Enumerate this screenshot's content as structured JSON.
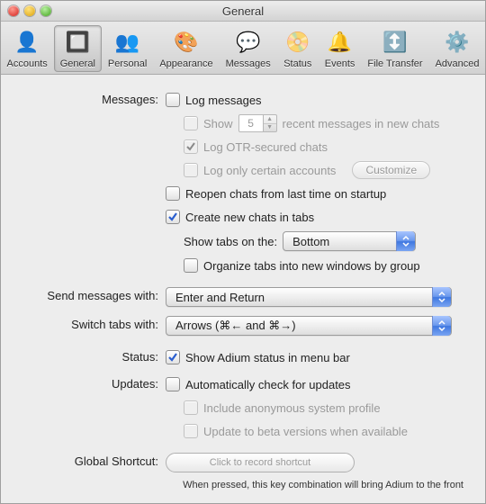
{
  "window": {
    "title": "General"
  },
  "toolbar": {
    "items": [
      {
        "label": "Accounts",
        "icon": "👤",
        "selected": false
      },
      {
        "label": "General",
        "icon": "🔲",
        "selected": true
      },
      {
        "label": "Personal",
        "icon": "👥",
        "selected": false
      },
      {
        "label": "Appearance",
        "icon": "🎨",
        "selected": false
      },
      {
        "label": "Messages",
        "icon": "💬",
        "selected": false
      },
      {
        "label": "Status",
        "icon": "📀",
        "selected": false
      },
      {
        "label": "Events",
        "icon": "🔔",
        "selected": false
      },
      {
        "label": "File Transfer",
        "icon": "↕️",
        "selected": false
      },
      {
        "label": "Advanced",
        "icon": "⚙️",
        "selected": false
      }
    ],
    "selected": "General"
  },
  "sections": {
    "messages": {
      "heading": "Messages:",
      "log_messages": {
        "label": "Log messages",
        "checked": false,
        "enabled": true
      },
      "show_recent": {
        "enabled": false,
        "pre": "Show",
        "value": "5",
        "post": "recent messages in new chats"
      },
      "log_otr": {
        "label": "Log OTR-secured chats",
        "checked": true,
        "enabled": false
      },
      "log_only": {
        "label": "Log only certain accounts",
        "checked": false,
        "enabled": false
      },
      "customize_label": "Customize",
      "reopen": {
        "label": "Reopen chats from last time on startup",
        "checked": false
      },
      "tabs": {
        "label": "Create new chats in tabs",
        "checked": true
      },
      "show_tabs_label": "Show tabs on the:",
      "show_tabs_value": "Bottom",
      "organize": {
        "label": "Organize tabs into new windows by group",
        "checked": false
      }
    },
    "send": {
      "heading": "Send messages with:",
      "value": "Enter and Return"
    },
    "switch": {
      "heading": "Switch tabs with:",
      "value": "Arrows (⌘← and ⌘→)"
    },
    "status": {
      "heading": "Status:",
      "show_menubar": {
        "label": "Show Adium status in menu bar",
        "checked": true
      }
    },
    "updates": {
      "heading": "Updates:",
      "auto": {
        "label": "Automatically check for updates",
        "checked": false
      },
      "profile": {
        "label": "Include anonymous system profile",
        "checked": false,
        "enabled": false
      },
      "beta": {
        "label": "Update to beta versions when available",
        "checked": false,
        "enabled": false
      }
    },
    "shortcut": {
      "heading": "Global Shortcut:",
      "placeholder": "Click to record shortcut",
      "footnote": "When pressed, this key combination will bring Adium to the front"
    }
  }
}
